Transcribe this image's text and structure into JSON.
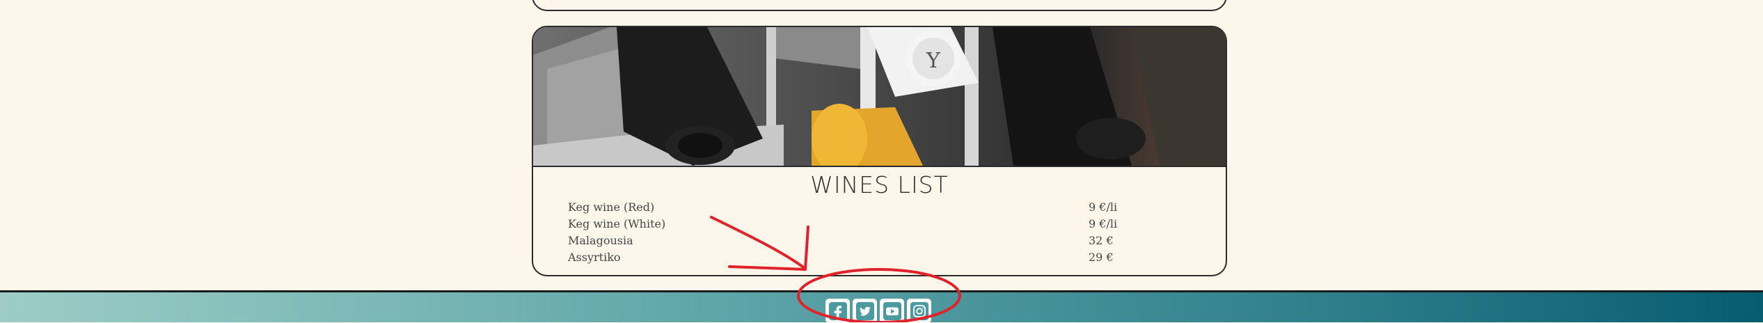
{
  "menu": {
    "title": "WINES LIST",
    "items": [
      {
        "name": "Keg wine (Red)",
        "price": "9 €/li"
      },
      {
        "name": "Keg wine (White)",
        "price": "9 €/li"
      },
      {
        "name": "Malagousia",
        "price": "32 €"
      },
      {
        "name": "Assyrtiko",
        "price": "29 €"
      }
    ]
  },
  "footer": {
    "gradient": [
      "#9dcdc6",
      "#5fa6a9",
      "#2f7f8c",
      "#075c70"
    ],
    "social": [
      {
        "icon": "facebook-icon"
      },
      {
        "icon": "twitter-icon"
      },
      {
        "icon": "youtube-icon"
      },
      {
        "icon": "instagram-icon"
      }
    ]
  },
  "annotation": {
    "color": "#e0232b"
  }
}
